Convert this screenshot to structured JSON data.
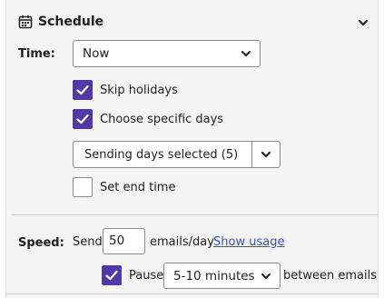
{
  "section": {
    "title": "Schedule",
    "icon": "calendar-icon",
    "collapse_icon": "chevron-down-icon"
  },
  "time": {
    "label": "Time:",
    "selected": "Now"
  },
  "options": {
    "skip_holidays": {
      "label": "Skip holidays",
      "checked": true
    },
    "choose_days": {
      "label": "Choose specific days",
      "checked": true
    },
    "days_dropdown": "Sending days selected (5)",
    "end_time": {
      "label": "Set end time",
      "checked": false
    }
  },
  "speed": {
    "label": "Speed:",
    "send_prefix": "Send",
    "emails_per_day": "50",
    "unit": "emails/day",
    "show_usage_link": "Show usage",
    "pause": {
      "label": "Pause",
      "checked": true,
      "selected": "5-10 minutes",
      "suffix": "between emails"
    }
  },
  "colors": {
    "accent": "#4f3aa8",
    "link": "#3b4fc9",
    "panel_bg": "#f5f5f5"
  }
}
